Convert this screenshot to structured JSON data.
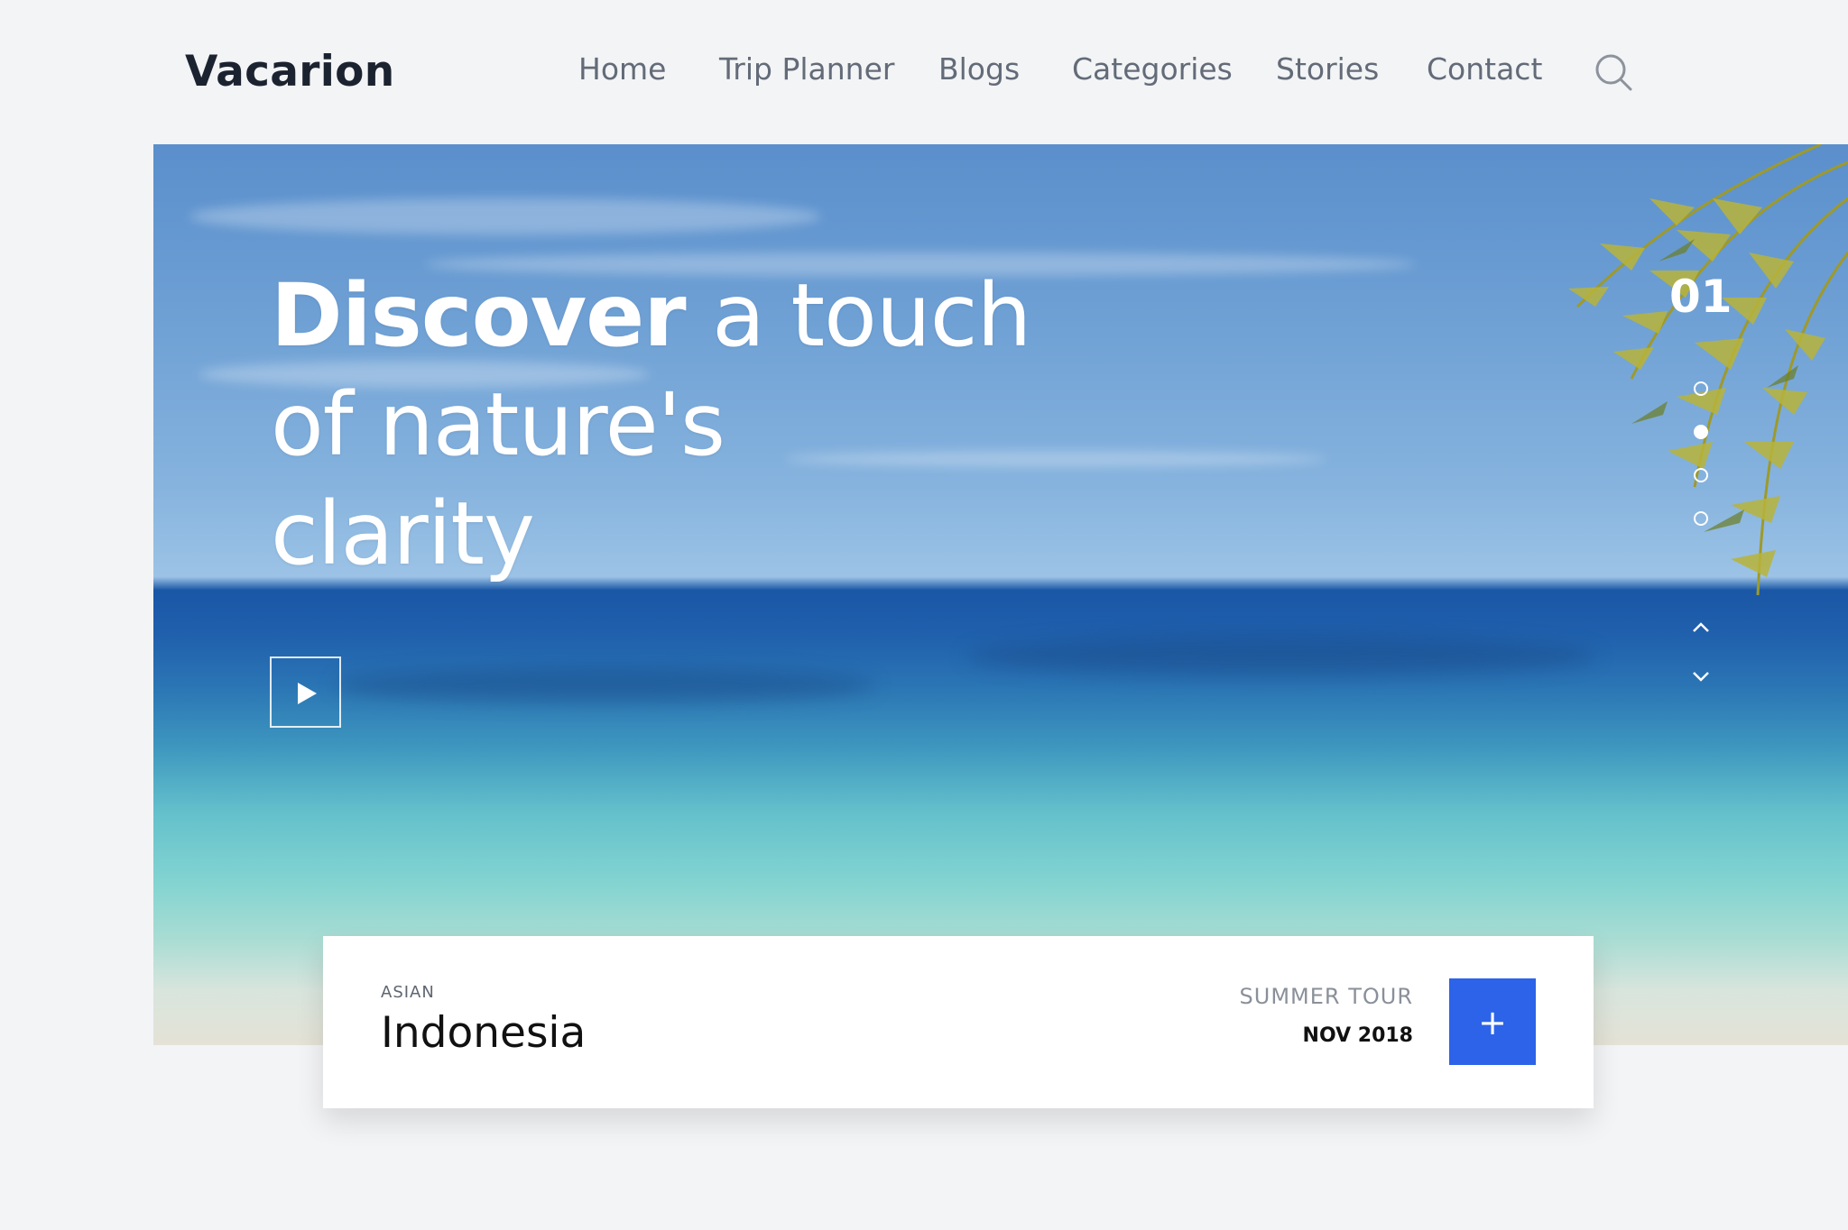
{
  "brand": {
    "name": "Vacarion"
  },
  "nav": {
    "items": [
      {
        "label": "Home"
      },
      {
        "label": "Trip Planner"
      },
      {
        "label": "Blogs"
      },
      {
        "label": "Categories"
      },
      {
        "label": "Stories"
      },
      {
        "label": "Contact"
      }
    ],
    "search_icon": "search-icon"
  },
  "hero": {
    "headline_strong": "Discover",
    "headline_rest_1": " a touch",
    "headline_line_2": "of nature's",
    "headline_line_3": "clarity",
    "play_icon": "play-icon",
    "slide_number": "01",
    "slide_count": 4,
    "active_slide_index": 1,
    "arrows": [
      "chevron-up-icon",
      "chevron-down-icon"
    ]
  },
  "card": {
    "category": "ASIAN",
    "title": "Indonesia",
    "tour_label": "SUMMER TOUR",
    "date": "NOV 2018",
    "button_label": "+"
  },
  "colors": {
    "accent": "#2c63e8",
    "background": "#f3f4f6",
    "logo_text": "#1c2330",
    "nav_text": "#636b78"
  }
}
